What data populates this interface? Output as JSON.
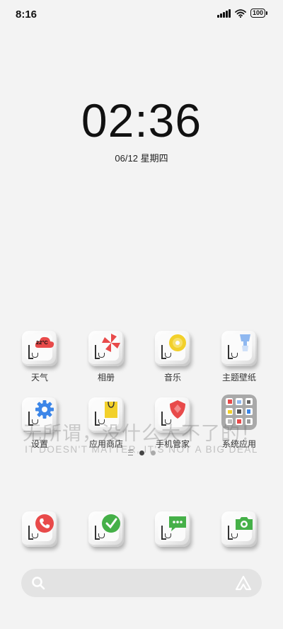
{
  "status_bar": {
    "time": "8:16",
    "battery": "100"
  },
  "clock": {
    "time": "02:36",
    "date": "06/12 星期四"
  },
  "apps_row1": [
    {
      "label": "天气",
      "icon": "weather-cloud-icon",
      "temp": "22°C"
    },
    {
      "label": "相册",
      "icon": "gallery-pinwheel-icon"
    },
    {
      "label": "音乐",
      "icon": "music-disc-icon"
    },
    {
      "label": "主题壁纸",
      "icon": "theme-brush-icon"
    }
  ],
  "apps_row2": [
    {
      "label": "设置",
      "icon": "gear-icon"
    },
    {
      "label": "应用商店",
      "icon": "store-bag-icon"
    },
    {
      "label": "手机管家",
      "icon": "security-shield-icon"
    },
    {
      "label": "系统应用",
      "icon": "folder-icon"
    }
  ],
  "dock": [
    {
      "icon": "phone-icon"
    },
    {
      "icon": "browser-globe-icon"
    },
    {
      "icon": "messages-icon"
    },
    {
      "icon": "camera-icon"
    }
  ],
  "watermark": {
    "chinese": "无所谓，没什么大不了的！",
    "english": "IT DOESN'T MATTER, IT'S NOT A BIG DEAL"
  },
  "pager": {
    "pages": 2,
    "current": 1
  },
  "colors": {
    "red": "#e84a4a",
    "yellow": "#f2d02a",
    "blue": "#3c86e8",
    "green": "#45b048",
    "background": "#f3f3f3"
  }
}
